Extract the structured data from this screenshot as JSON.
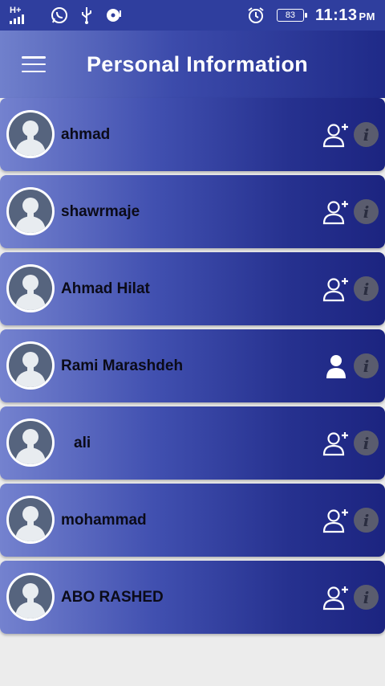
{
  "status_bar": {
    "network": "H+",
    "battery": "83",
    "time": "11:13",
    "ampm": "PM"
  },
  "header": {
    "title": "Personal Information"
  },
  "contacts": [
    {
      "name": "ahmad",
      "action_icon": "add-user-icon"
    },
    {
      "name": "shawrmaje",
      "action_icon": "add-user-icon"
    },
    {
      "name": "Ahmad Hilat",
      "action_icon": "add-user-icon"
    },
    {
      "name": "Rami Marashdeh",
      "action_icon": "user-icon"
    },
    {
      "name": "ali",
      "action_icon": "add-user-icon"
    },
    {
      "name": "mohammad",
      "action_icon": "add-user-icon"
    },
    {
      "name": "ABO RASHED",
      "action_icon": "add-user-icon"
    }
  ],
  "colors": {
    "status_bar": "#2f3e9e",
    "card_start": "#7482cf",
    "card_end": "#1c2480",
    "background": "#ececec"
  }
}
